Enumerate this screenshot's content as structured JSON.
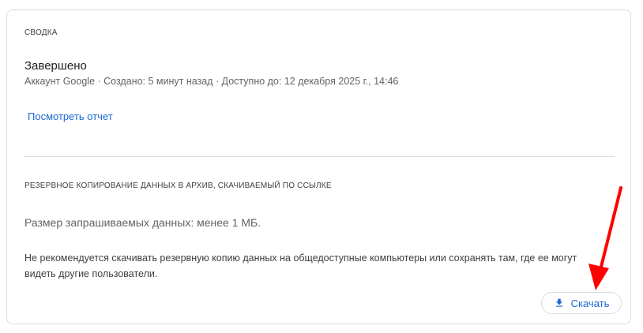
{
  "summary": {
    "section_title": "СВОДКА",
    "status": "Завершено",
    "meta": "Аккаунт Google · Создано: 5 минут назад · Доступно до: 12 декабря 2025 г., 14:46",
    "report_link": "Посмотреть отчет"
  },
  "backup": {
    "section_title": "РЕЗЕРВНОЕ КОПИРОВАНИЕ ДАННЫХ В АРХИВ, СКАЧИВАЕМЫЙ ПО ССЫЛКЕ",
    "size_text": "Размер запрашиваемых данных: менее 1 МБ.",
    "warning": "Не рекомендуется скачивать резервную копию данных на общедоступные компьютеры или сохранять там, где ее могут видеть другие пользователи.",
    "download_label": "Скачать",
    "download_icon": "download-icon"
  },
  "colors": {
    "accent": "#1967d2",
    "annotation_arrow": "#ff0000",
    "border": "#dadce0"
  }
}
